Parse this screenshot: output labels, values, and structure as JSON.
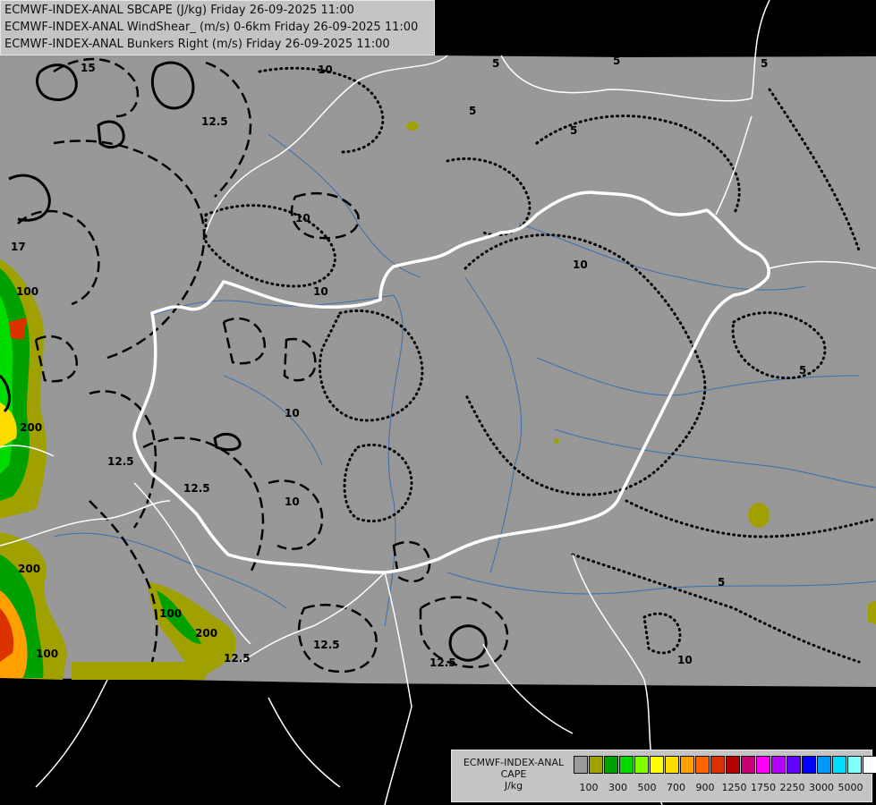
{
  "header": {
    "line1": "ECMWF-INDEX-ANAL SBCAPE (J/kg) Friday 26-09-2025 11:00",
    "line2": "ECMWF-INDEX-ANAL WindShear_ (m/s) 0-6km Friday 26-09-2025 11:00",
    "line3": "ECMWF-INDEX-ANAL Bunkers Right (m/s) Friday 26-09-2025 11:00"
  },
  "legend": {
    "title1": "ECMWF-INDEX-ANAL",
    "title2": "CAPE",
    "title3": "J/kg",
    "colors": [
      "#9a9a9a",
      "#a0a000",
      "#00a000",
      "#00dc00",
      "#80ff00",
      "#ffff00",
      "#ffdc00",
      "#ffa000",
      "#ff6400",
      "#dc3200",
      "#b40000",
      "#c80078",
      "#ff00ff",
      "#b400ff",
      "#6400ff",
      "#0000ff",
      "#0096ff",
      "#00dcff",
      "#80ffff",
      "#ffffff"
    ],
    "ticks": [
      "100",
      "300",
      "500",
      "700",
      "900",
      "1250",
      "1750",
      "2250",
      "3000",
      "5000"
    ]
  },
  "map": {
    "contour_labels": [
      "15",
      "5",
      "10",
      "5",
      "5",
      "5",
      "5",
      "12.5",
      "10",
      "10",
      "10",
      "17",
      "100",
      "10",
      "200",
      "12.5",
      "12.5",
      "12.5",
      "10",
      "12.5",
      "12.5",
      "200",
      "100",
      "200",
      "100",
      "5",
      "5",
      "10"
    ]
  }
}
